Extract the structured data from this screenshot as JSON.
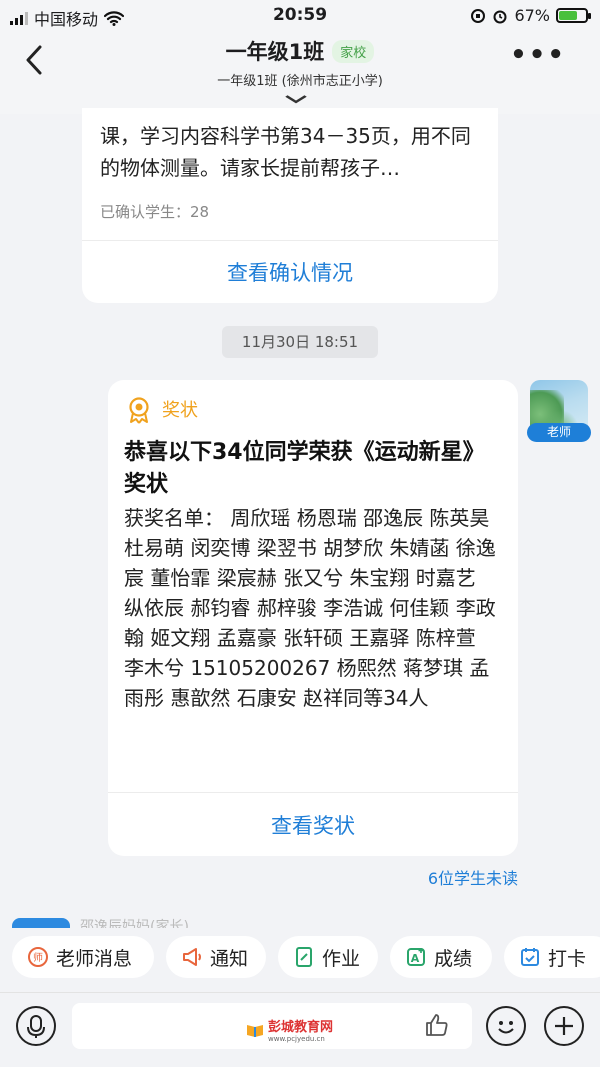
{
  "status": {
    "carrier": "中国移动",
    "time": "20:59",
    "battery": "67%"
  },
  "header": {
    "title": "一年级1班",
    "tag": "家校",
    "subtitle": "一年级1班 (徐州市志正小学)"
  },
  "prev_card": {
    "text": "课，学习内容科学书第34－35页，用不同的物体测量。请家长提前帮孩子…",
    "confirmed": "已确认学生：28",
    "link": "查看确认情况"
  },
  "timestamp": "11月30日 18:51",
  "sender": {
    "role": "老师"
  },
  "award_card": {
    "type_label": "奖状",
    "title": "恭喜以下34位同学荣获《运动新星》奖状",
    "list": "获奖名单：  周欣瑶 杨恩瑞 邵逸辰 陈英昊 杜易萌 闵奕博 梁翌书 胡梦欣 朱婧菡 徐逸宸 董怡霏 梁宸赫 张又兮 朱宝翔 时嘉艺 纵依辰 郝钧睿 郝梓骏 李浩诚 何佳颖 李政翰 姬文翔 孟嘉豪 张轩硕 王嘉驿 陈梓萱 李木兮 15105200267 杨熙然 蒋梦琪 孟雨彤 惠歆然 石康安 赵祥同等34人",
    "link": "查看奖状",
    "unread": "6位学生未读"
  },
  "peek_text": "邵逸辰妈妈(家长)",
  "quick_actions": [
    {
      "label": "老师消息",
      "icon": "teacher-message-icon",
      "color": "#e8663d"
    },
    {
      "label": "通知",
      "icon": "megaphone-icon",
      "color": "#e8663d"
    },
    {
      "label": "作业",
      "icon": "homework-icon",
      "color": "#2aa56b"
    },
    {
      "label": "成绩",
      "icon": "grades-icon",
      "color": "#2aa56b"
    },
    {
      "label": "打卡",
      "icon": "checkin-icon",
      "color": "#2d8ae0"
    }
  ],
  "watermark": {
    "text": "彭城教育网",
    "url": "www.pcjyedu.cn"
  },
  "colors": {
    "link": "#1f7ed7",
    "award": "#f0a21e",
    "tag": "#43a047"
  }
}
